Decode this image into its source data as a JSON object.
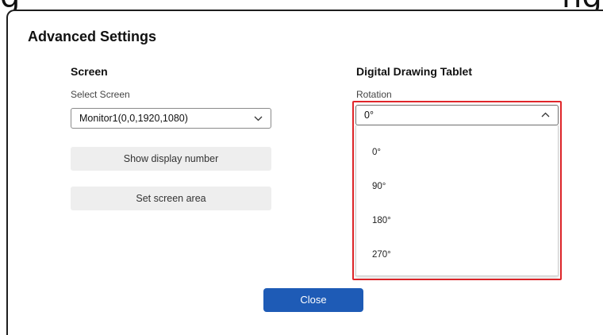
{
  "background_text": "g                                                       ng",
  "dialog": {
    "title": "Advanced Settings",
    "screen": {
      "heading": "Screen",
      "select_label": "Select Screen",
      "select_value": "Monitor1(0,0,1920,1080)",
      "show_display_number": "Show display number",
      "set_screen_area": "Set screen area"
    },
    "tablet": {
      "heading": "Digital Drawing Tablet",
      "rotation_label": "Rotation",
      "rotation_value": "0°",
      "rotation_options": [
        "0°",
        "90°",
        "180°",
        "270°"
      ]
    },
    "close_label": "Close"
  },
  "colors": {
    "accent": "#1e5bb6",
    "highlight": "#e0262a",
    "button_gray": "#eeeeee"
  },
  "icons": {
    "screen_select": "chevron-down-icon",
    "rotation_select": "chevron-up-icon"
  }
}
